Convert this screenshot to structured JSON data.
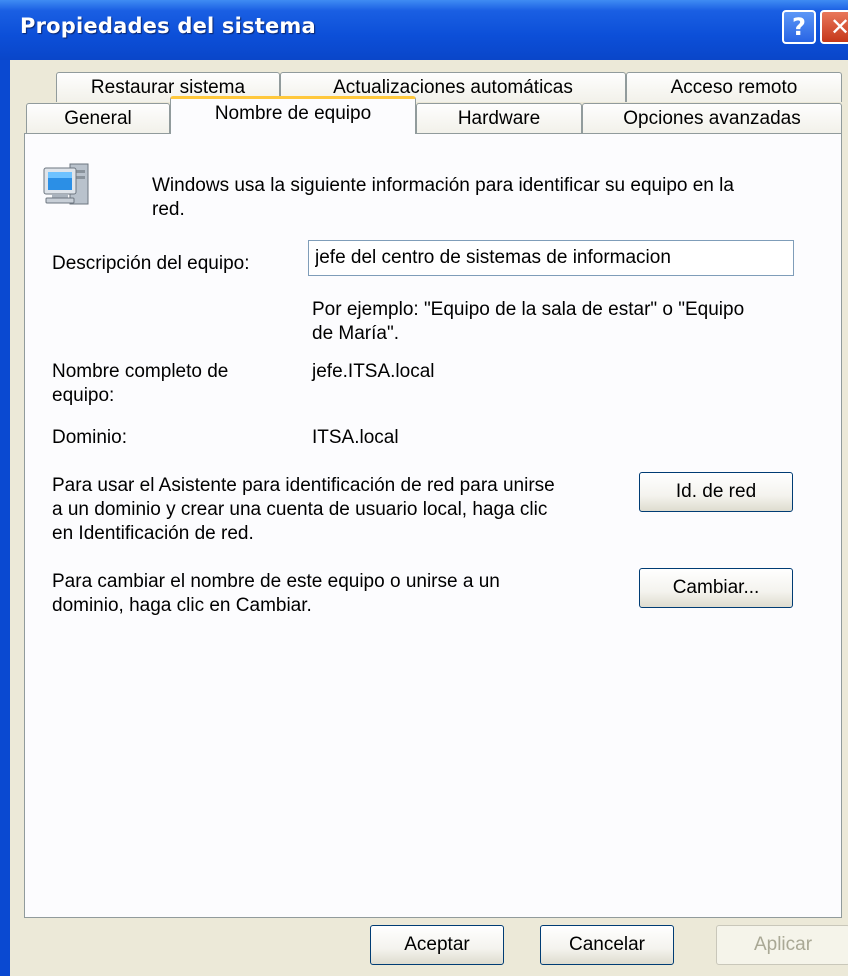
{
  "window": {
    "title": "Propiedades del sistema",
    "help_label": "?",
    "close_label": "✕"
  },
  "tabs_row1": [
    {
      "label": "Restaurar sistema"
    },
    {
      "label": "Actualizaciones automáticas"
    },
    {
      "label": "Acceso remoto"
    }
  ],
  "tabs_row2": [
    {
      "label": "General"
    },
    {
      "label": "Nombre de equipo",
      "active": true
    },
    {
      "label": "Hardware"
    },
    {
      "label": "Opciones avanzadas"
    }
  ],
  "panel": {
    "intro_line1": "Windows usa la siguiente información para identificar su equipo en la",
    "intro_line2": "red.",
    "description_label": "Descripción del equipo:",
    "description_value": "jefe del centro de sistemas de informacion",
    "example_line1": "Por ejemplo: \"Equipo de la sala de estar\" o \"Equipo",
    "example_line2": "de María\".",
    "fullname_label_line1": "Nombre completo de",
    "fullname_label_line2": "equipo:",
    "fullname_value": "jefe.ITSA.local",
    "domain_label": "Dominio:",
    "domain_value": "ITSA.local",
    "network_text_line1": "Para usar el Asistente para identificación de red para unirse",
    "network_text_line2": "a un dominio y crear una cuenta de usuario local, haga clic",
    "network_text_line3": "en Identificación de red.",
    "network_button": "Id. de red",
    "change_text_line1": "Para cambiar el nombre de este equipo o unirse a un",
    "change_text_line2": "dominio, haga clic en Cambiar.",
    "change_button": "Cambiar..."
  },
  "footer": {
    "ok": "Aceptar",
    "cancel": "Cancelar",
    "apply": "Aplicar"
  }
}
